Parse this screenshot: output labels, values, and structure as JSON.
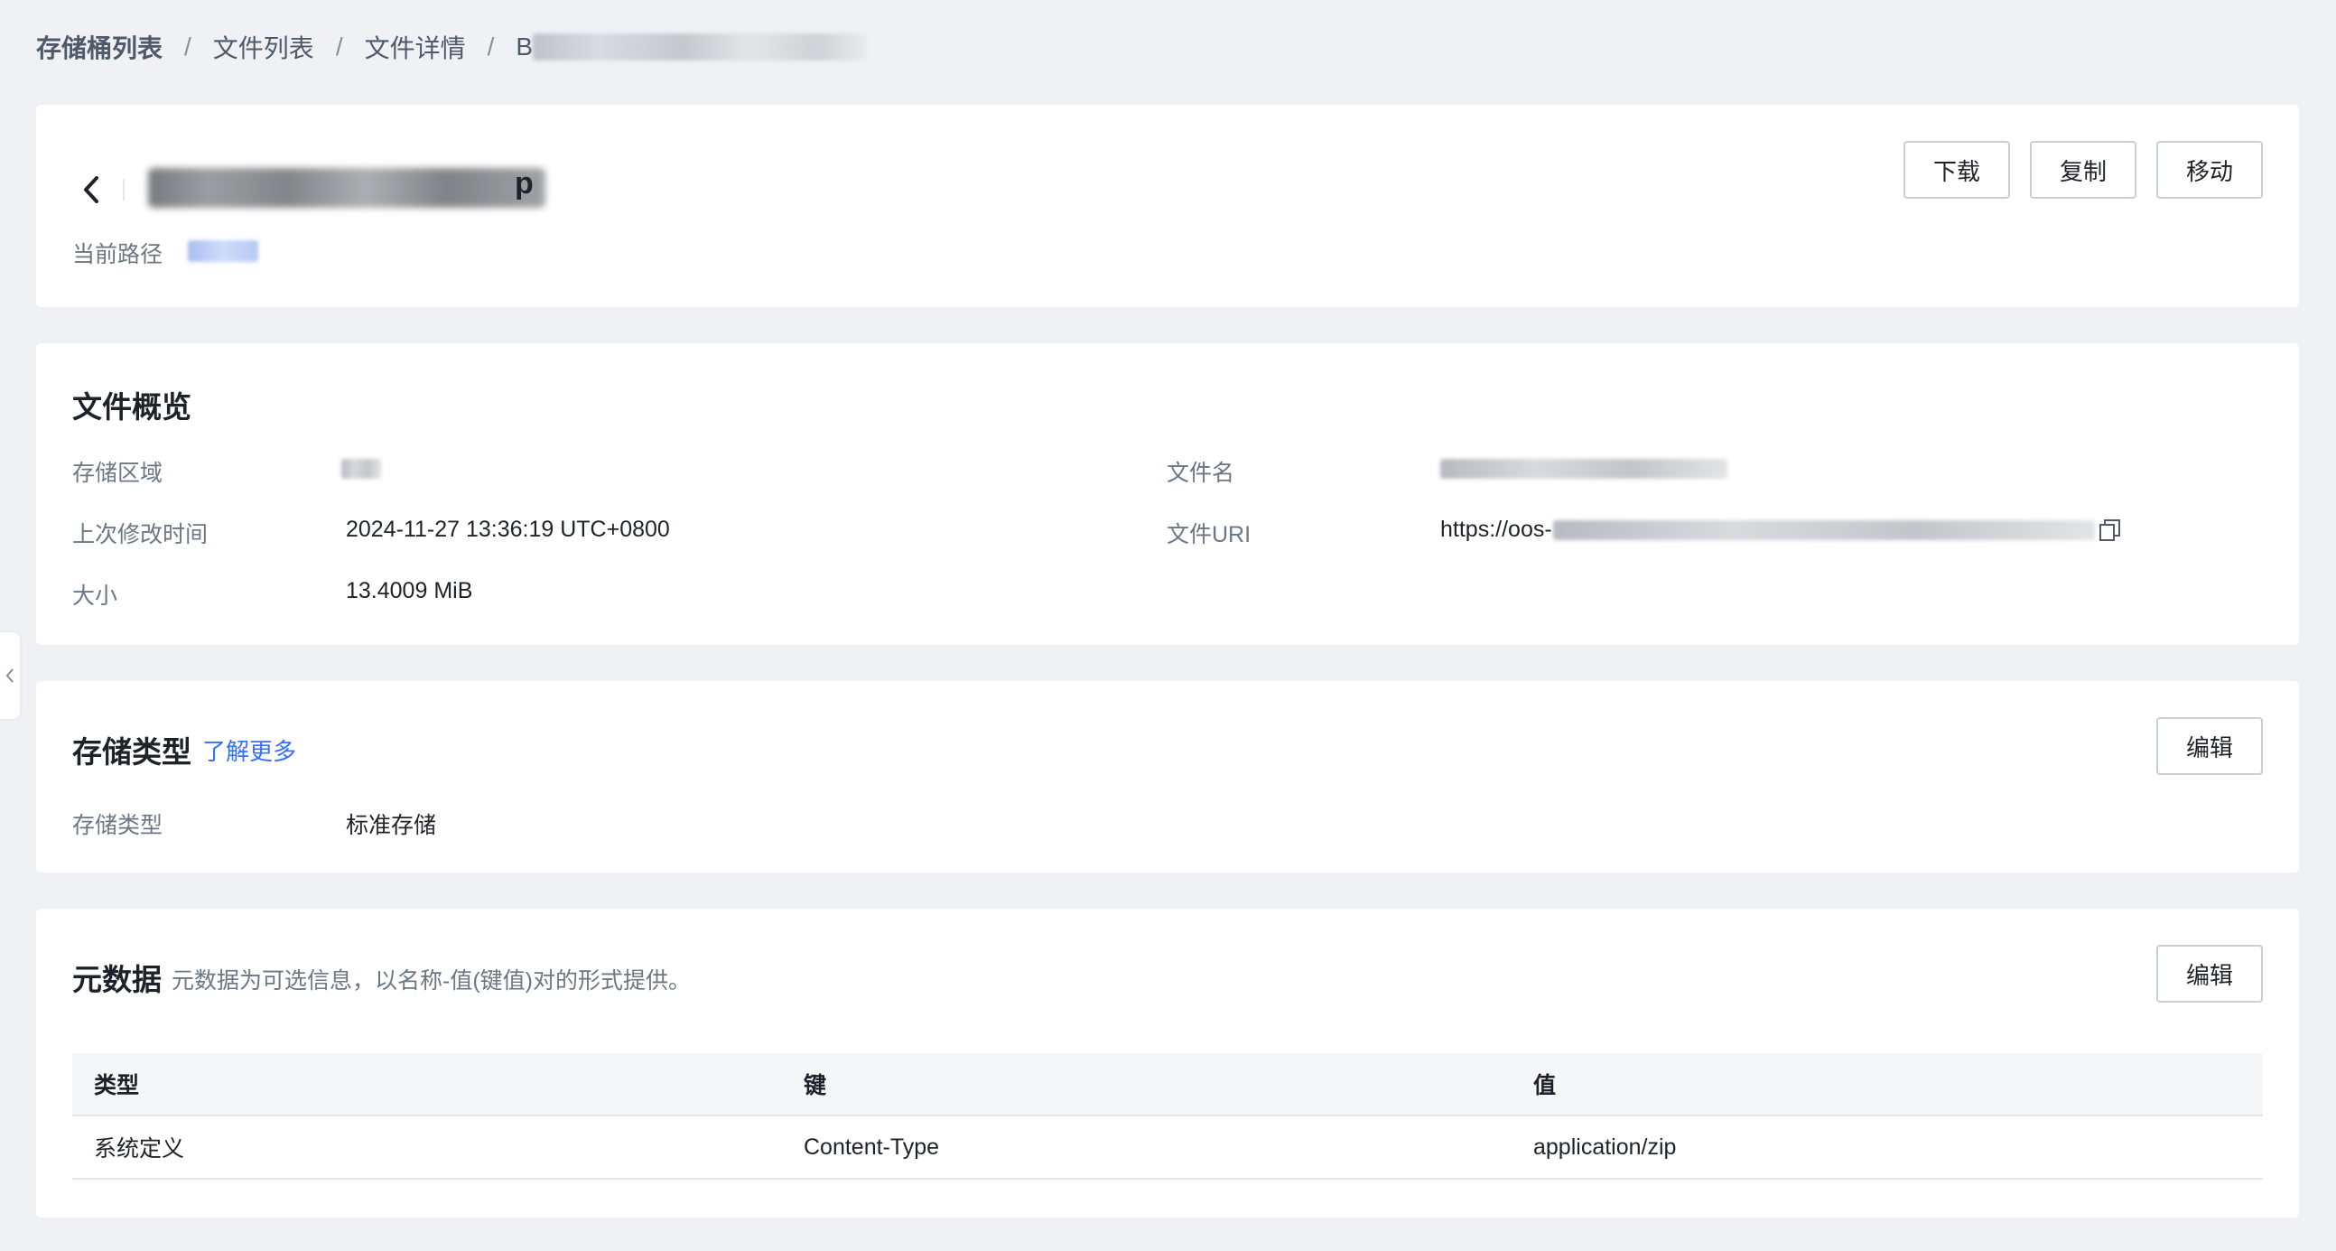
{
  "breadcrumb": {
    "items": [
      "存储桶列表",
      "文件列表",
      "文件详情"
    ],
    "separator": "/",
    "current_prefix": "B"
  },
  "header": {
    "file_title_tail": "p",
    "path_label": "当前路径",
    "buttons": {
      "download": "下载",
      "copy": "复制",
      "move": "移动"
    }
  },
  "overview": {
    "title": "文件概览",
    "region_label": "存储区域",
    "modified_label": "上次修改时间",
    "modified_value": "2024-11-27 13:36:19 UTC+0800",
    "size_label": "大小",
    "size_value": "13.4009 MiB",
    "filename_label": "文件名",
    "uri_label": "文件URI",
    "uri_prefix": "https://oos-"
  },
  "storage": {
    "title": "存储类型",
    "learn_more": "了解更多",
    "edit": "编辑",
    "type_label": "存储类型",
    "type_value": "标准存储"
  },
  "metadata": {
    "title": "元数据",
    "description": "元数据为可选信息，以名称-值(键值)对的形式提供。",
    "edit": "编辑",
    "columns": [
      "类型",
      "键",
      "值"
    ],
    "rows": [
      [
        "系统定义",
        "Content-Type",
        "application/zip"
      ]
    ]
  },
  "colors": {
    "background": "#eff1f5",
    "link": "#3370ff",
    "text": "#1f2329",
    "muted": "#6b7785"
  }
}
